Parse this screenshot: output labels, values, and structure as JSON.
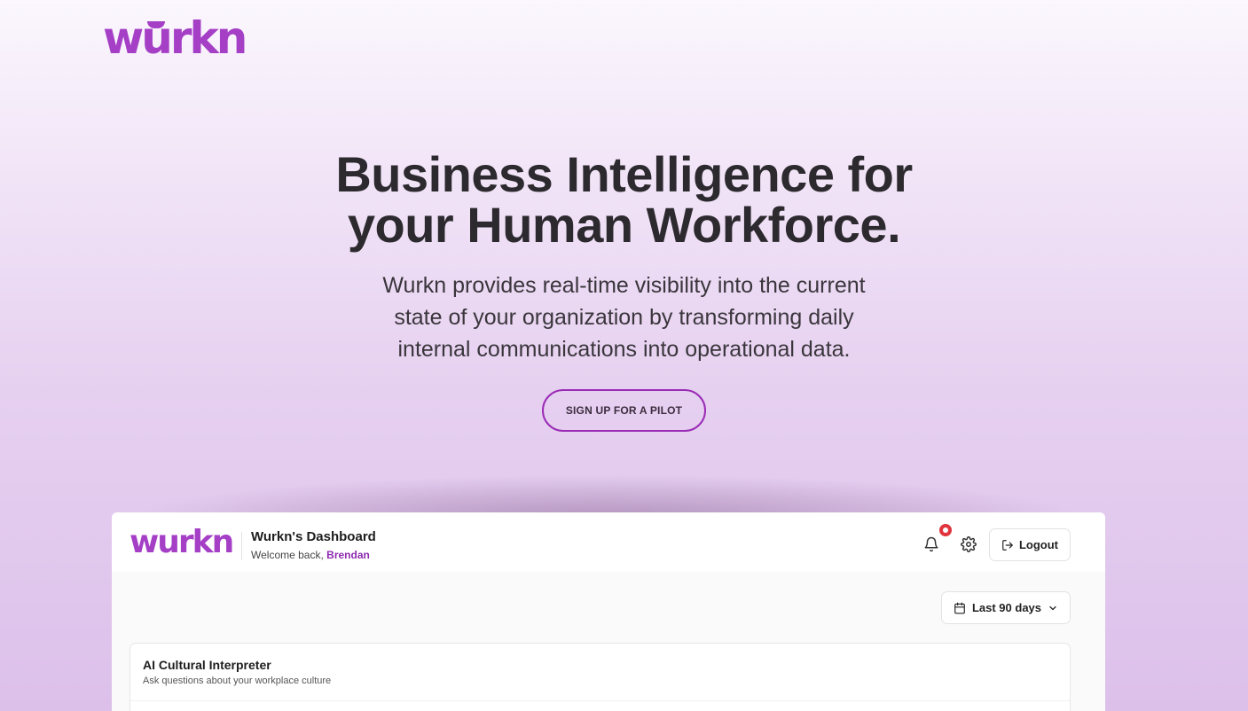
{
  "brand": {
    "logo_text": "wurkn",
    "accent_color": "#a43fc6"
  },
  "hero": {
    "title_line1": "Business Intelligence for",
    "title_line2": "your Human Workforce.",
    "description": "Wurkn provides real-time visibility into the current state of your organization by transforming daily internal communications into operational data.",
    "cta_label": "SIGN UP FOR A PILOT"
  },
  "dashboard": {
    "logo_text": "wurkn",
    "title": "Wurkn's Dashboard",
    "welcome_prefix": "Welcome back, ",
    "user_name": "Brendan",
    "icons": {
      "notifications": "bell-icon",
      "settings": "gear-icon",
      "logout": "logout-icon",
      "calendar": "calendar-icon",
      "dropdown": "chevron-down-icon"
    },
    "notification_dot_color": "#e0343e",
    "logout_label": "Logout",
    "date_range": "Last 90 days",
    "card": {
      "title": "AI Cultural Interpreter",
      "subtitle": "Ask questions about your workplace culture"
    }
  }
}
